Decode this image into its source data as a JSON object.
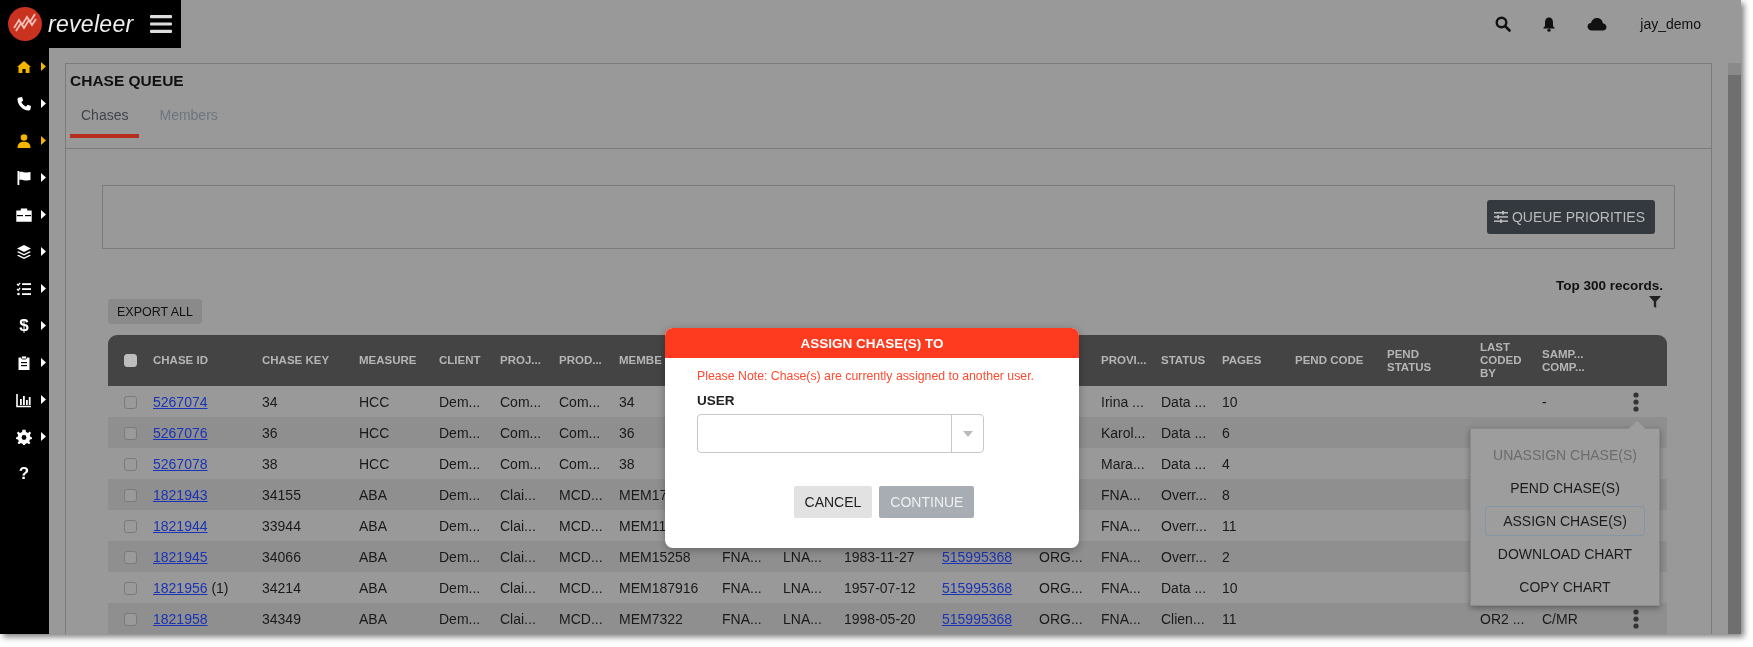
{
  "brand": {
    "name": "reveleer"
  },
  "topbar": {
    "user": "jay_demo"
  },
  "sidebar": {
    "items": [
      {
        "kind": "icon",
        "highlighted": true
      },
      {
        "kind": "icon",
        "highlighted": false
      },
      {
        "kind": "icon",
        "highlighted": true
      },
      {
        "kind": "icon",
        "highlighted": false
      },
      {
        "kind": "icon",
        "highlighted": false
      },
      {
        "kind": "icon",
        "highlighted": false
      },
      {
        "kind": "icon",
        "highlighted": false
      },
      {
        "kind": "glyph",
        "glyph": "$",
        "highlighted": false
      },
      {
        "kind": "icon",
        "highlighted": false
      },
      {
        "kind": "icon",
        "highlighted": false
      },
      {
        "kind": "icon",
        "highlighted": false
      },
      {
        "kind": "glyph",
        "glyph": "?",
        "highlighted": false
      }
    ]
  },
  "page": {
    "title": "CHASE QUEUE",
    "tabs": [
      {
        "label": "Chases",
        "selected": true
      },
      {
        "label": "Members",
        "selected": false
      }
    ],
    "queue_priorities_button": "QUEUE PRIORITIES",
    "record_note": "Top 300 records.",
    "export_button": "EXPORT ALL"
  },
  "table": {
    "select_all_checked": false,
    "columns": [
      {
        "label": "CHASE ID"
      },
      {
        "label": "CHASE KEY"
      },
      {
        "label": "MEASURE"
      },
      {
        "label": "CLIENT"
      },
      {
        "label": "PROJ..."
      },
      {
        "label": "PROD..."
      },
      {
        "label": "MEMBE"
      },
      {},
      {},
      {},
      {},
      {},
      {
        "label": "PROVI..."
      },
      {
        "label": "STATUS"
      },
      {
        "label": "PAGES"
      },
      {
        "label": "PEND CODE"
      },
      {
        "label": "PEND\nSTATUS"
      },
      {
        "label": "LAST\nCODED\nBY"
      },
      {
        "label": "SAMP...\nCOMP..."
      }
    ],
    "rows": [
      {
        "checked": false,
        "menu_button": true,
        "cells": [
          "5267074",
          "34",
          "HCC",
          "Dem...",
          "Com...",
          "Com...",
          "34",
          null,
          null,
          null,
          null,
          null,
          "Irina ...",
          "Data ...",
          "10",
          null,
          null,
          null,
          "-"
        ]
      },
      {
        "checked": false,
        "cells": [
          "5267076",
          "36",
          "HCC",
          "Dem...",
          "Com...",
          "Com...",
          "36",
          null,
          null,
          null,
          null,
          null,
          "Karol...",
          "Data ...",
          "6",
          null,
          null,
          null,
          null
        ]
      },
      {
        "checked": false,
        "cells": [
          "5267078",
          "38",
          "HCC",
          "Dem...",
          "Com...",
          "Com...",
          "38",
          null,
          null,
          null,
          null,
          null,
          "Mara...",
          "Data ...",
          "4",
          null,
          null,
          null,
          null
        ]
      },
      {
        "checked": false,
        "cells": [
          "1821943",
          "34155",
          "ABA",
          "Dem...",
          "Clai...",
          "MCD...",
          "MEM17",
          null,
          null,
          null,
          null,
          null,
          "FNA...",
          "Overr...",
          "8",
          null,
          null,
          null,
          null
        ]
      },
      {
        "checked": false,
        "cells": [
          "1821944",
          "33944",
          "ABA",
          "Dem...",
          "Clai...",
          "MCD...",
          "MEM11",
          null,
          null,
          null,
          null,
          null,
          "FNA...",
          "Overr...",
          "11",
          null,
          null,
          null,
          null
        ]
      },
      {
        "checked": false,
        "cells": [
          "1821945",
          "34066",
          "ABA",
          "Dem...",
          "Clai...",
          "MCD...",
          "MEM15258",
          "FNA...",
          "LNA...",
          "1983-11-27",
          "515995368",
          "ORG...",
          "FNA...",
          "Overr...",
          "2",
          null,
          null,
          null,
          null
        ]
      },
      {
        "checked": false,
        "note": "(1)",
        "cells": [
          "1821956",
          "34214",
          "ABA",
          "Dem...",
          "Clai...",
          "MCD...",
          "MEM187916",
          "FNA...",
          "LNA...",
          "1957-07-12",
          "515995368",
          "ORG...",
          "FNA...",
          "Data ...",
          "10",
          null,
          null,
          null,
          null
        ]
      },
      {
        "checked": false,
        "menu_button": true,
        "cells": [
          "1821958",
          "34349",
          "ABA",
          "Dem...",
          "Clai...",
          "MCD...",
          "MEM7322",
          "FNA...",
          "LNA...",
          "1998-05-20",
          "515995368",
          "ORG...",
          "FNA...",
          "Clien...",
          "11",
          null,
          null,
          "OR2 ...",
          "C/MR"
        ]
      }
    ]
  },
  "row_menu": {
    "items": [
      {
        "label": "UNASSIGN CHASE(S)",
        "disabled": true,
        "selected": false
      },
      {
        "label": "PEND CHASE(S)",
        "disabled": false,
        "selected": false
      },
      {
        "label": "ASSIGN CHASE(S)",
        "disabled": false,
        "selected": true
      },
      {
        "label": "DOWNLOAD CHART",
        "disabled": false,
        "selected": false
      },
      {
        "label": "COPY CHART",
        "disabled": false,
        "selected": false
      }
    ]
  },
  "dialog": {
    "title": "ASSIGN CHASE(S) TO",
    "note": "Please Note: Chase(s) are currently assigned to another user.",
    "field_label": "USER",
    "buttons": [
      {
        "label": "CANCEL",
        "disabled": false
      },
      {
        "label": "CONTINUE",
        "disabled": true
      }
    ]
  }
}
